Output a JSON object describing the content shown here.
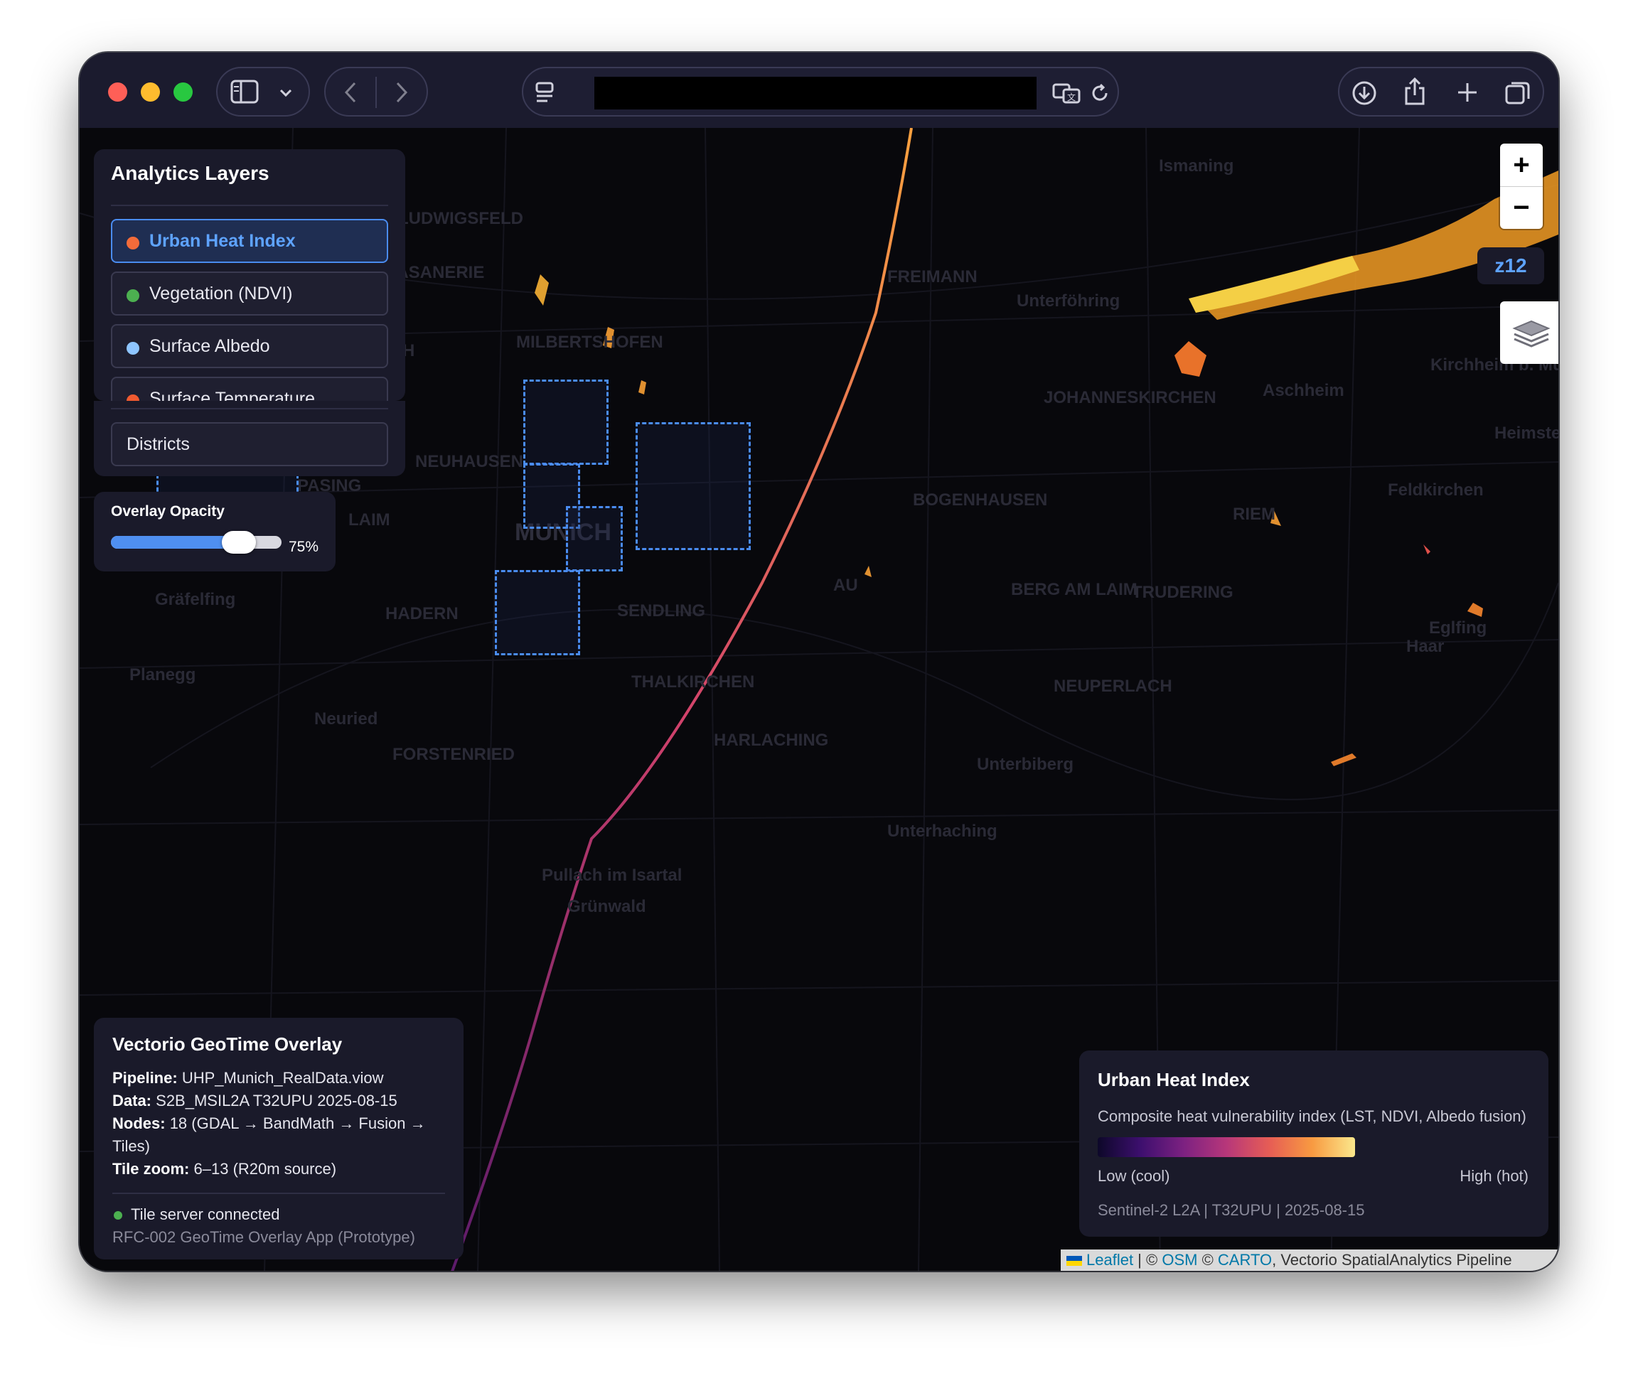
{
  "toolbar": {
    "address": ""
  },
  "layers_panel": {
    "title": "Analytics Layers",
    "layers": [
      {
        "label": "Urban Heat Index",
        "dot_color": "#f26b3a",
        "active": true
      },
      {
        "label": "Vegetation (NDVI)",
        "dot_color": "#4cb050",
        "active": false
      },
      {
        "label": "Surface Albedo",
        "dot_color": "#8ec5ff",
        "active": false
      },
      {
        "label": "Surface Temperature",
        "dot_color": "#f05a30",
        "active": false
      }
    ],
    "districts_label": "Districts"
  },
  "opacity": {
    "title": "Overlay Opacity",
    "value_label": "75%",
    "value": 0.75
  },
  "zoom": {
    "in": "+",
    "out": "−",
    "level": "z12"
  },
  "map_labels": [
    "Ismaning",
    "Unterföhring",
    "FREIMANN",
    "FASANERIE",
    "MOOSACH",
    "MILBERTSHOFEN",
    "JOHANNESKIRCHEN",
    "Aschheim",
    "Kirchheim b. Münc",
    "Heimstetten",
    "Feldkirchen",
    "NEUHAUSEN",
    "BOGENHAUSEN",
    "RIEM",
    "LAIM",
    "PASING",
    "MUNICH",
    "AU",
    "BERG AM LAIM",
    "TRUDERING",
    "Gräfelfing",
    "HADERN",
    "SENDLING",
    "Haar",
    "Eglfing",
    "Planegg",
    "THALKIRCHEN",
    "NEUPERLACH",
    "Neuried",
    "HARLACHING",
    "Unterbiberg",
    "Unterhaching",
    "Pullach im Isartal",
    "Grünwald",
    "LUDWIGSFELD",
    "FORSTENRIED"
  ],
  "info_panel": {
    "title": "Vectorio GeoTime Overlay",
    "pipeline_label": "Pipeline:",
    "pipeline_value": "UHP_Munich_RealData.viow",
    "data_label": "Data:",
    "data_value": "S2B_MSIL2A T32UPU 2025-08-15",
    "nodes_label": "Nodes:",
    "nodes_value": "18 (GDAL → BandMath → Fusion →",
    "nodes_value_2": "Tiles)",
    "tilezoom_label": "Tile zoom:",
    "tilezoom_value": "6–13 (R20m source)",
    "status": "Tile server connected",
    "footer": "RFC-002 GeoTime Overlay App (Prototype)"
  },
  "legend": {
    "title": "Urban Heat Index",
    "subtitle": "Composite heat vulnerability index (LST, NDVI, Albedo fusion)",
    "low": "Low (cool)",
    "high": "High (hot)",
    "source": "Sentinel-2 L2A | T32UPU | 2025-08-15"
  },
  "attribution": {
    "leaflet": "Leaflet",
    "sep1": " | © ",
    "osm": "OSM",
    "sep2": " © ",
    "carto": "CARTO",
    "rest": ", Vectorio SpatialAnalytics Pipeline"
  },
  "colors": {
    "accent": "#4a8cf0",
    "heat_low": "#0d0829",
    "heat_mid": "#b7377a",
    "heat_high": "#fbe88c",
    "status_ok": "#4cb050"
  }
}
